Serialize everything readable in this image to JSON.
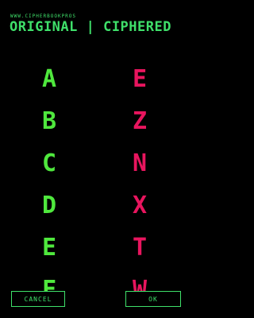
{
  "header": {
    "url": "WWW.CIPHERBOOKPROS",
    "title": "ORIGINAL | CIPHERED"
  },
  "original": [
    "A",
    "B",
    "C",
    "D",
    "E",
    "F"
  ],
  "ciphered": [
    "E",
    "Z",
    "N",
    "X",
    "T",
    "W"
  ],
  "buttons": {
    "cancel": "CANCEL",
    "ok": "OK"
  },
  "colors": {
    "background": "#000000",
    "primary_green": "#3fe06a",
    "letter_green": "#4fe83d",
    "cipher_red": "#e8155e"
  }
}
